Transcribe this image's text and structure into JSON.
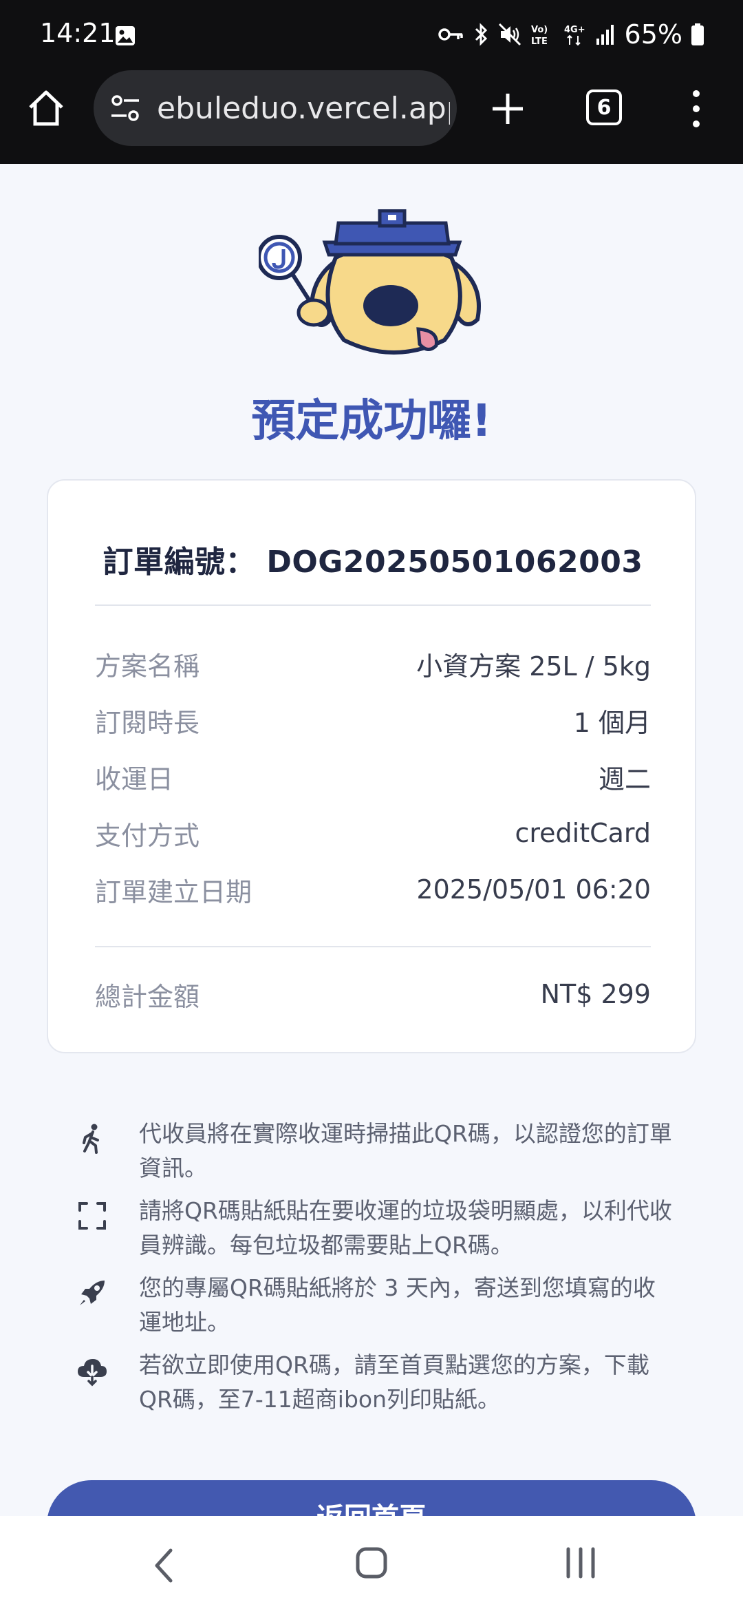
{
  "status_bar": {
    "time": "14:21",
    "battery": "65%",
    "network_label": "4G+",
    "volte_label": "Vo) LTE"
  },
  "browser": {
    "url": "ebuleduo.vercel.app",
    "tab_count": "6"
  },
  "page": {
    "success_title": "預定成功囉!",
    "order_number_label": "訂單編號：",
    "order_number": "DOG20250501062003",
    "details": [
      {
        "label": "方案名稱",
        "value": "小資方案 25L / 5kg"
      },
      {
        "label": "訂閱時長",
        "value": "1 個月"
      },
      {
        "label": "收運日",
        "value": "週二"
      },
      {
        "label": "支付方式",
        "value": "creditCard"
      },
      {
        "label": "訂單建立日期",
        "value": "2025/05/01 06:20"
      }
    ],
    "total": {
      "label": "總計金額",
      "value": "NT$ 299"
    },
    "info_items": [
      {
        "icon": "walking-person-icon",
        "text": "代收員將在實際收運時掃描此QR碼，以認證您的訂單資訊。"
      },
      {
        "icon": "scan-frame-icon",
        "text": "請將QR碼貼紙貼在要收運的垃圾袋明顯處，以利代收員辨識。每包垃圾都需要貼上QR碼。"
      },
      {
        "icon": "rocket-icon",
        "text": "您的專屬QR碼貼紙將於 3 天內，寄送到您填寫的收運地址。"
      },
      {
        "icon": "cloud-download-icon",
        "text": "若欲立即使用QR碼，請至首頁點選您的方案，下載QR碼，至7-11超商ibon列印貼紙。"
      }
    ],
    "primary_button_label": "返回首頁"
  },
  "colors": {
    "brand_blue": "#3f57b3",
    "button_blue": "#4359b0",
    "chrome_dark": "#0f0f11"
  }
}
